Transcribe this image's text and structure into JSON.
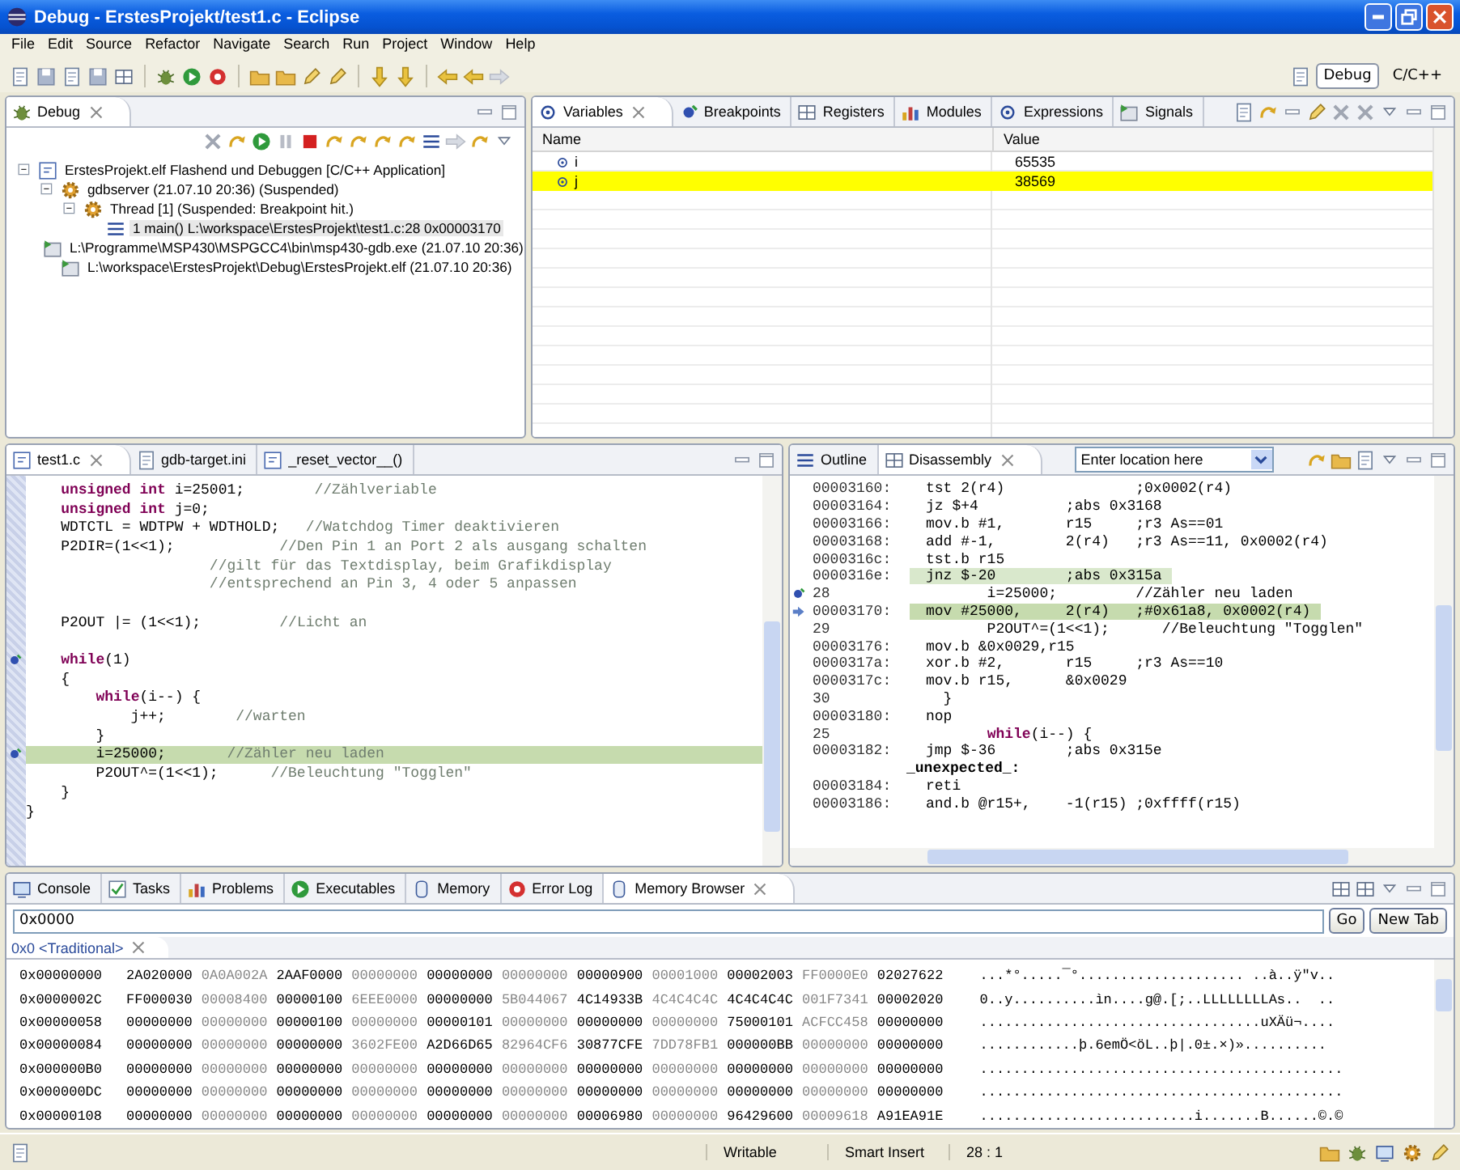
{
  "window": {
    "title": "Debug - ErstesProjekt/test1.c - Eclipse"
  },
  "menu": [
    "File",
    "Edit",
    "Source",
    "Refactor",
    "Navigate",
    "Search",
    "Run",
    "Project",
    "Window",
    "Help"
  ],
  "perspectives": [
    {
      "label": "Debug",
      "selected": true
    },
    {
      "label": "C/C++",
      "selected": false
    }
  ],
  "debug_view": {
    "tabs": [
      {
        "label": "Debug",
        "selected": true
      }
    ],
    "tree": [
      {
        "label": "ErstesProjekt.elf Flashend und Debuggen [C/C++ Application]",
        "kind": "launch",
        "expanded": true,
        "selected": false,
        "children": [
          {
            "label": "gdbserver (21.07.10 20:36) (Suspended)",
            "kind": "target",
            "expanded": true,
            "selected": false,
            "children": [
              {
                "label": "Thread [1] (Suspended: Breakpoint hit.)",
                "kind": "thread",
                "expanded": true,
                "selected": false,
                "children": [
                  {
                    "label": "1 main() L:\\workspace\\ErstesProjekt\\test1.c:28 0x00003170",
                    "kind": "frame",
                    "selected": true
                  }
                ]
              }
            ]
          },
          {
            "label": "L:\\Programme\\MSP430\\MSPGCC4\\bin\\msp430-gdb.exe (21.07.10 20:36)",
            "kind": "process",
            "selected": false
          },
          {
            "label": "L:\\workspace\\ErstesProjekt\\Debug\\ErstesProjekt.elf (21.07.10 20:36)",
            "kind": "process",
            "selected": false
          }
        ]
      }
    ]
  },
  "variables_view": {
    "tabs": [
      {
        "label": "Variables",
        "selected": true
      },
      {
        "label": "Breakpoints",
        "selected": false
      },
      {
        "label": "Registers",
        "selected": false
      },
      {
        "label": "Modules",
        "selected": false
      },
      {
        "label": "Expressions",
        "selected": false
      },
      {
        "label": "Signals",
        "selected": false
      }
    ],
    "columns": [
      "Name",
      "Value"
    ],
    "rows": [
      {
        "name": "i",
        "value": "65535",
        "changed": false
      },
      {
        "name": "j",
        "value": "38569",
        "changed": true
      }
    ]
  },
  "editor": {
    "tabs": [
      {
        "label": "test1.c",
        "selected": true
      },
      {
        "label": "gdb-target.ini",
        "selected": false
      },
      {
        "label": "_reset_vector__()",
        "selected": false
      }
    ],
    "lines": [
      {
        "kind": "code",
        "code": "    **unsigned int** i=25001;",
        "comment": "        //Zählveriable",
        "current": false,
        "breakpoint": false
      },
      {
        "kind": "code",
        "code": "    **unsigned int** j=0;",
        "current": false,
        "breakpoint": false
      },
      {
        "kind": "code",
        "code": "    WDTCTL = WDTPW + WDTHOLD;",
        "comment": "   //Watchdog Timer deaktivieren",
        "current": false,
        "breakpoint": false
      },
      {
        "kind": "code",
        "code": "    P2DIR=(1<<1);",
        "comment": "            //Den Pin 1 an Port 2 als ausgang schalten",
        "current": false,
        "breakpoint": false
      },
      {
        "kind": "code",
        "comment": "                     //gilt für das Textdisplay, beim Grafikdisplay",
        "current": false,
        "breakpoint": false
      },
      {
        "kind": "code",
        "comment": "                     //entsprechend an Pin 3, 4 oder 5 anpassen",
        "current": false,
        "breakpoint": false
      },
      {
        "kind": "blank",
        "current": false,
        "breakpoint": false
      },
      {
        "kind": "code",
        "code": "    P2OUT |= (1<<1);",
        "comment": "         //Licht an",
        "current": false,
        "breakpoint": false
      },
      {
        "kind": "blank",
        "current": false,
        "breakpoint": false
      },
      {
        "kind": "code",
        "code": "    **while**(1)",
        "current": false,
        "breakpoint": true
      },
      {
        "kind": "code",
        "code": "    {",
        "current": false,
        "breakpoint": false
      },
      {
        "kind": "code",
        "code": "        **while**(i--) {",
        "current": false,
        "breakpoint": false
      },
      {
        "kind": "code",
        "code": "            j++;",
        "comment": "        //warten",
        "current": false,
        "breakpoint": false
      },
      {
        "kind": "code",
        "code": "        }",
        "current": false,
        "breakpoint": false
      },
      {
        "kind": "code",
        "code": "        i=25000;",
        "comment": "       //Zähler neu laden",
        "current": true,
        "breakpoint": true
      },
      {
        "kind": "code",
        "code": "        P2OUT^=(1<<1);",
        "comment": "      //Beleuchtung \"Togglen\"",
        "current": false,
        "breakpoint": false
      },
      {
        "kind": "code",
        "code": "    }",
        "current": false,
        "breakpoint": false
      },
      {
        "kind": "code",
        "code": "}",
        "current": false,
        "breakpoint": false
      }
    ]
  },
  "disassembly": {
    "tabs": [
      {
        "label": "Outline",
        "selected": false
      },
      {
        "label": "Disassembly",
        "selected": true
      }
    ],
    "location": {
      "value": "Enter location here"
    },
    "lines": [
      {
        "kind": "asm",
        "address": "00003160:",
        "text": "tst 2(r4)               ;0x0002(r4)",
        "highlighted": false,
        "current": false,
        "breakpoint": false
      },
      {
        "kind": "asm",
        "address": "00003164:",
        "text": "jz $+4          ;abs 0x3168",
        "highlighted": false,
        "current": false,
        "breakpoint": false
      },
      {
        "kind": "asm",
        "address": "00003166:",
        "text": "mov.b #1,       r15     ;r3 As==01",
        "highlighted": false,
        "current": false,
        "breakpoint": false
      },
      {
        "kind": "asm",
        "address": "00003168:",
        "text": "add #-1,        2(r4)   ;r3 As==11, 0x0002(r4)",
        "highlighted": false,
        "current": false,
        "breakpoint": false
      },
      {
        "kind": "asm",
        "address": "0000316c:",
        "text": "tst.b r15",
        "highlighted": false,
        "current": false,
        "breakpoint": false
      },
      {
        "kind": "asm",
        "address": "0000316e:",
        "text": "jnz $-20        ;abs 0x315a",
        "highlighted": true,
        "current": false,
        "breakpoint": false
      },
      {
        "kind": "source",
        "address": "28",
        "text": "       i=25000;         //Zähler neu laden",
        "highlighted": false,
        "current": false,
        "breakpoint": true
      },
      {
        "kind": "asm",
        "address": "00003170:",
        "text": "mov #25000,     2(r4)   ;#0x61a8, 0x0002(r4)",
        "highlighted": true,
        "current": true,
        "breakpoint": false
      },
      {
        "kind": "source",
        "address": "29",
        "text": "       P2OUT^=(1<<1);      //Beleuchtung \"Togglen\"",
        "highlighted": false,
        "current": false,
        "breakpoint": false
      },
      {
        "kind": "asm",
        "address": "00003176:",
        "text": "mov.b &0x0029,r15",
        "highlighted": false,
        "current": false,
        "breakpoint": false
      },
      {
        "kind": "asm",
        "address": "0000317a:",
        "text": "xor.b #2,       r15     ;r3 As==10",
        "highlighted": false,
        "current": false,
        "breakpoint": false
      },
      {
        "kind": "asm",
        "address": "0000317c:",
        "text": "mov.b r15,      &0x0029",
        "highlighted": false,
        "current": false,
        "breakpoint": false
      },
      {
        "kind": "source",
        "address": "30",
        "text": "  }",
        "highlighted": false,
        "current": false,
        "breakpoint": false
      },
      {
        "kind": "asm",
        "address": "00003180:",
        "text": "nop",
        "highlighted": false,
        "current": false,
        "breakpoint": false
      },
      {
        "kind": "source",
        "address": "25",
        "text": "       **while**(i--) {",
        "highlighted": false,
        "current": false,
        "breakpoint": false
      },
      {
        "kind": "asm",
        "address": "00003182:",
        "text": "jmp $-36        ;abs 0x315e",
        "highlighted": false,
        "current": false,
        "breakpoint": false
      },
      {
        "kind": "label",
        "text": "_unexpected_:",
        "highlighted": false,
        "current": false,
        "breakpoint": false
      },
      {
        "kind": "asm",
        "address": "00003184:",
        "text": "reti",
        "highlighted": false,
        "current": false,
        "breakpoint": false
      },
      {
        "kind": "asm",
        "address": "00003186:",
        "text": "and.b @r15+,    -1(r15) ;0xffff(r15)",
        "highlighted": false,
        "current": false,
        "breakpoint": false
      }
    ]
  },
  "bottom_view": {
    "tabs": [
      {
        "label": "Console",
        "selected": false
      },
      {
        "label": "Tasks",
        "selected": false
      },
      {
        "label": "Problems",
        "selected": false
      },
      {
        "label": "Executables",
        "selected": false
      },
      {
        "label": "Memory",
        "selected": false
      },
      {
        "label": "Error Log",
        "selected": false
      },
      {
        "label": "Memory Browser",
        "selected": true
      }
    ],
    "address": {
      "value": "0x0000"
    },
    "go": "Go",
    "new_tab": "New Tab",
    "rendering_tabs": [
      {
        "label": "0x0 <Traditional>",
        "selected": true
      }
    ],
    "rows": [
      {
        "address": "0x00000000",
        "words": [
          "2A020000",
          "0A0A002A",
          "2AAF0000",
          "00000000",
          "00000000",
          "00000000",
          "00000900",
          "00001000",
          "00002003",
          "FF0000E0",
          "02027622"
        ],
        "ascii": "...*°.....¯°.................... ..à..ÿ\"v.."
      },
      {
        "address": "0x0000002C",
        "words": [
          "FF000030",
          "00008400",
          "00000100",
          "6EEE0000",
          "00000000",
          "5B044067",
          "4C14933B",
          "4C4C4C4C",
          "4C4C4C4C",
          "001F7341",
          "00002020"
        ],
        "ascii": "0..y..........ìn....g@.[;..LLLLLLLLAs..  .."
      },
      {
        "address": "0x00000058",
        "words": [
          "00000000",
          "00000000",
          "00000100",
          "00000000",
          "00000101",
          "00000000",
          "00000000",
          "00000000",
          "75000101",
          "ACFCC458",
          "00000000"
        ],
        "ascii": "..................................uXÄü¬...."
      },
      {
        "address": "0x00000084",
        "words": [
          "00000000",
          "00000000",
          "00000000",
          "3602FE00",
          "A2D66D65",
          "82964CF6",
          "30877CFE",
          "7DD78FB1",
          "000000BB",
          "00000000",
          "00000000"
        ],
        "ascii": "............þ.6emÖ<öL..þ|.0±.×)».........."
      },
      {
        "address": "0x000000B0",
        "words": [
          "00000000",
          "00000000",
          "00000000",
          "00000000",
          "00000000",
          "00000000",
          "00000000",
          "00000000",
          "00000000",
          "00000000",
          "00000000"
        ],
        "ascii": "............................................"
      },
      {
        "address": "0x000000DC",
        "words": [
          "00000000",
          "00000000",
          "00000000",
          "00000000",
          "00000000",
          "00000000",
          "00000000",
          "00000000",
          "00000000",
          "00000000",
          "00000000"
        ],
        "ascii": "............................................"
      },
      {
        "address": "0x00000108",
        "words": [
          "00000000",
          "00000000",
          "00000000",
          "00000000",
          "00000000",
          "00000000",
          "00006980",
          "00000000",
          "96429600",
          "00009618",
          "A91EA91E"
        ],
        "ascii": "..........................i.......B......©.©"
      }
    ]
  },
  "status_bar": [
    "Writable",
    "Smart Insert",
    "28 : 1"
  ]
}
